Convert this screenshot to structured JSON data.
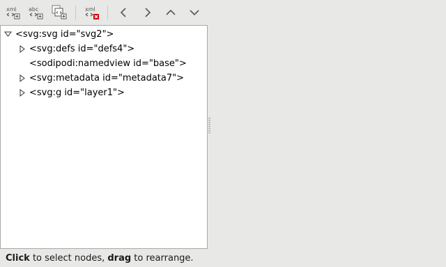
{
  "toolbar": {
    "buttons": [
      {
        "name": "new-element-node",
        "icon": "xml-node-new-icon",
        "text": "xml"
      },
      {
        "name": "new-text-node",
        "icon": "text-node-new-icon",
        "text": "abc"
      },
      {
        "name": "duplicate-node",
        "icon": "duplicate-node-icon",
        "text": ""
      },
      {
        "name": "delete-node",
        "icon": "xml-node-delete-icon",
        "text": "xml"
      },
      {
        "name": "unindent-node",
        "icon": "chevron-left-icon",
        "text": ""
      },
      {
        "name": "indent-node",
        "icon": "chevron-right-icon",
        "text": ""
      },
      {
        "name": "raise-node",
        "icon": "chevron-up-icon",
        "text": ""
      },
      {
        "name": "lower-node",
        "icon": "chevron-down-icon",
        "text": ""
      }
    ]
  },
  "tree": {
    "nodes": [
      {
        "label": "<svg:svg id=\"svg2\">",
        "expanded": true
      },
      {
        "label": "<svg:defs id=\"defs4\">",
        "expanded": false
      },
      {
        "label": "<sodipodi:namedview id=\"base\">",
        "expanded": null
      },
      {
        "label": "<svg:metadata id=\"metadata7\">",
        "expanded": false
      },
      {
        "label": "<svg:g id=\"layer1\">",
        "expanded": false
      }
    ]
  },
  "status": {
    "click": "Click",
    "middle": " to select nodes, ",
    "drag": "drag",
    "end": " to rearrange."
  },
  "colors": {
    "background": "#e8e8e7",
    "panel": "#ffffff",
    "icon_gray": "#555753",
    "delete_red": "#cc0000"
  }
}
